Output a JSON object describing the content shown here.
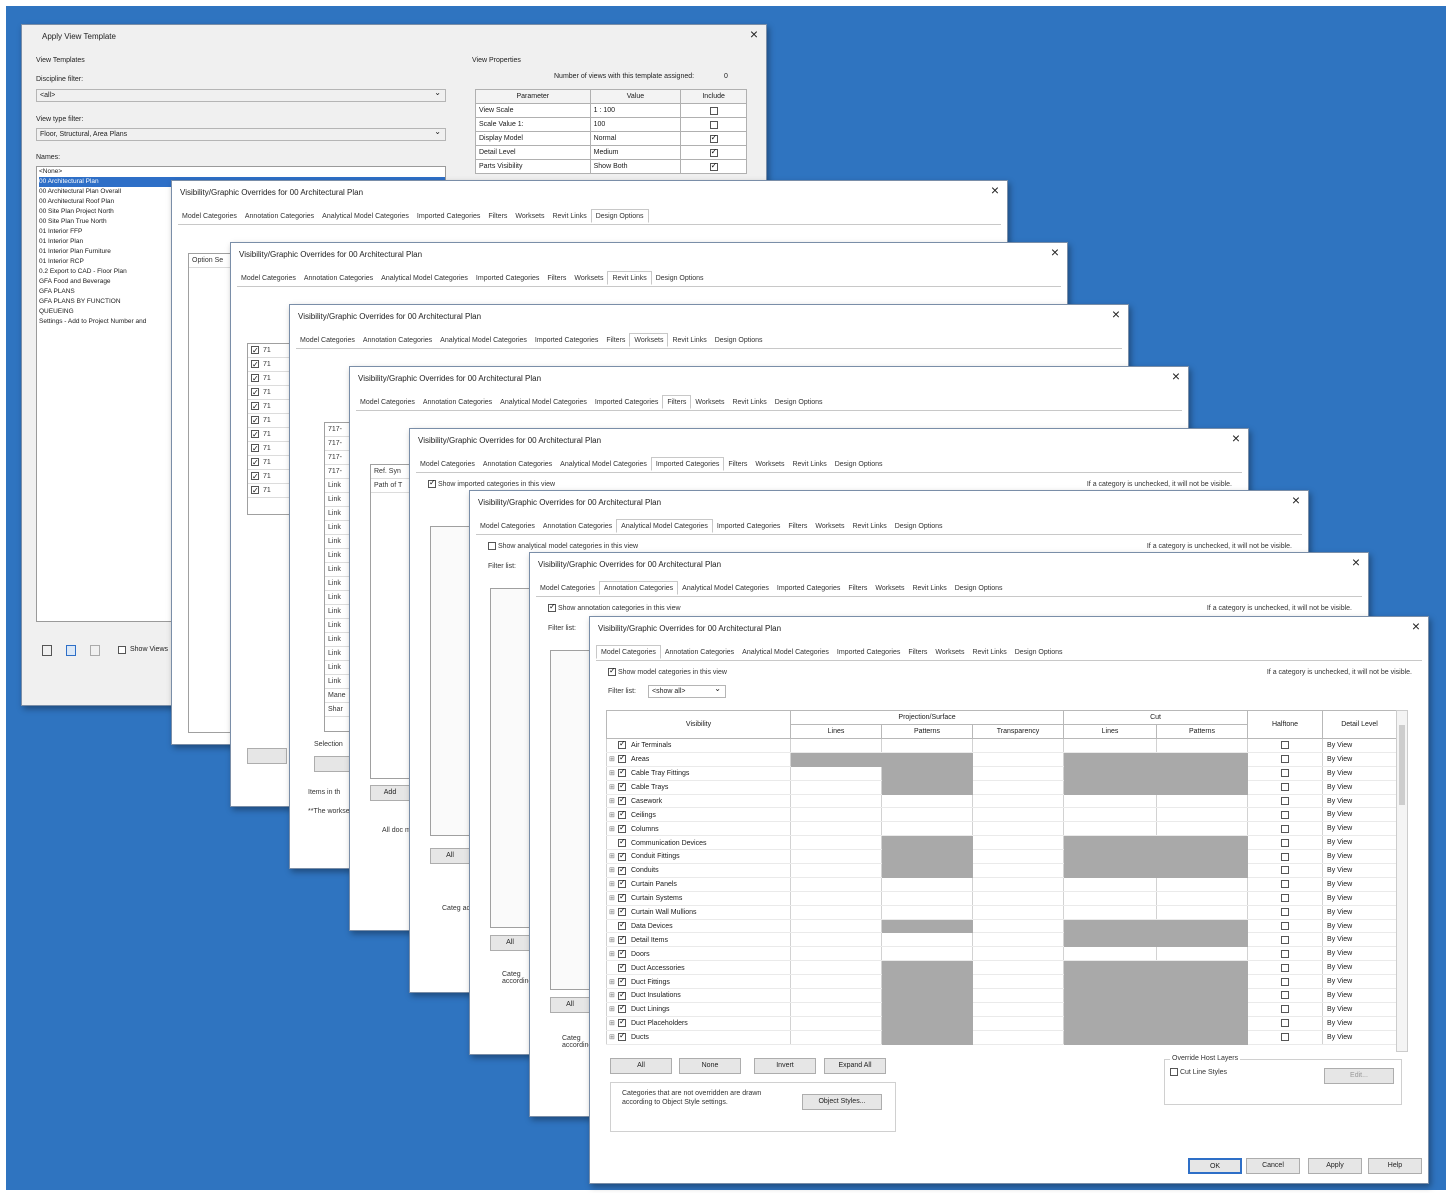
{
  "apply_template": {
    "title": "Apply View Template",
    "view_templates_label": "View Templates",
    "discipline_label": "Discipline filter:",
    "discipline_value": "<all>",
    "view_type_label": "View type filter:",
    "view_type_value": "Floor, Structural, Area Plans",
    "names_label": "Names:",
    "names": [
      "<None>",
      "00 Architectural Plan",
      "00 Architectural Plan Overall",
      "00 Architectural Roof Plan",
      "00 Site Plan Project North",
      "00 Site Plan True North",
      "01 Interior FFP",
      "01 Interior Plan",
      "01 Interior Plan Furniture",
      "01 Interior RCP",
      "0.2 Export to CAD - Floor Plan",
      "GFA Food and Beverage",
      "GFA PLANS",
      "GFA PLANS BY FUNCTION",
      "QUEUEING",
      "Settings - Add to Project Number and"
    ],
    "selected_index": 1,
    "view_properties_label": "View Properties",
    "num_views_label": "Number of views with this template assigned:",
    "num_views_value": "0",
    "props_headers": [
      "Parameter",
      "Value",
      "Include"
    ],
    "props_rows": [
      {
        "param": "View Scale",
        "value": "1 : 100",
        "include": false
      },
      {
        "param": "Scale Value  1:",
        "value": "100",
        "include": false
      },
      {
        "param": "Display Model",
        "value": "Normal",
        "include": true
      },
      {
        "param": "Detail Level",
        "value": "Medium",
        "include": true
      },
      {
        "param": "Parts Visibility",
        "value": "Show Both",
        "include": true
      }
    ],
    "show_views_label": "Show Views"
  },
  "vg_title": "Visibility/Graphic Overrides for 00 Architectural Plan",
  "tabs": [
    "Model Categories",
    "Annotation Categories",
    "Analytical Model Categories",
    "Imported Categories",
    "Filters",
    "Worksets",
    "Revit Links",
    "Design Options"
  ],
  "stack": {
    "option_set_label": "Option Se",
    "ref_label": "Ref. Syn",
    "path_label": "Path of T",
    "selection_label": "Selection",
    "items_label": "Items in th",
    "note_label": "**The workse",
    "all_label": "All",
    "show_imported": "Show imported categories in this view",
    "show_analytical": "Show analytical model categories in this view",
    "show_annotation": "Show annotation categories in this view",
    "unchecked_note": "If a category is unchecked, it will not be visible.",
    "filter_label": "Filter list:",
    "link_rows": [
      "71",
      "71",
      "71",
      "71",
      "71",
      "71",
      "71",
      "71",
      "71",
      "71",
      "71"
    ],
    "workset_rows": [
      "717-",
      "717-",
      "717-",
      "717-",
      "Link",
      "Link",
      "Link",
      "Link",
      "Link",
      "Link",
      "Link",
      "Link",
      "Link",
      "Link",
      "Link",
      "Link",
      "Link",
      "Link",
      "Link",
      "Mane",
      "Shar"
    ],
    "categ_label": "Categ according",
    "add_label": "Add"
  },
  "front": {
    "show_model": "Show model categories in this view",
    "unchecked_note": "If a category is unchecked, it will not be visible.",
    "filter_label": "Filter list:",
    "filter_value": "<show all>",
    "col_visibility": "Visibility",
    "col_projection": "Projection/Surface",
    "col_cut": "Cut",
    "col_halftone": "Halftone",
    "col_detail": "Detail Level",
    "sub_lines": "Lines",
    "sub_patterns": "Patterns",
    "sub_transparency": "Transparency",
    "rows": [
      {
        "name": "Air Terminals",
        "exp": false,
        "gray": []
      },
      {
        "name": "Areas",
        "exp": true,
        "gray": [
          "pl",
          "pp",
          "cl",
          "cp"
        ]
      },
      {
        "name": "Cable Tray Fittings",
        "exp": true,
        "gray": [
          "pp",
          "cl",
          "cp"
        ]
      },
      {
        "name": "Cable Trays",
        "exp": true,
        "gray": [
          "pp",
          "cl",
          "cp"
        ]
      },
      {
        "name": "Casework",
        "exp": true,
        "gray": []
      },
      {
        "name": "Ceilings",
        "exp": true,
        "gray": []
      },
      {
        "name": "Columns",
        "exp": true,
        "gray": []
      },
      {
        "name": "Communication Devices",
        "exp": false,
        "gray": [
          "pp",
          "cl",
          "cp"
        ]
      },
      {
        "name": "Conduit Fittings",
        "exp": true,
        "gray": [
          "pp",
          "cl",
          "cp"
        ]
      },
      {
        "name": "Conduits",
        "exp": true,
        "gray": [
          "pp",
          "cl",
          "cp"
        ]
      },
      {
        "name": "Curtain Panels",
        "exp": true,
        "gray": []
      },
      {
        "name": "Curtain Systems",
        "exp": true,
        "gray": []
      },
      {
        "name": "Curtain Wall Mullions",
        "exp": true,
        "gray": []
      },
      {
        "name": "Data Devices",
        "exp": false,
        "gray": [
          "pp",
          "cl",
          "cp"
        ]
      },
      {
        "name": "Detail Items",
        "exp": true,
        "gray": [
          "cl",
          "cp"
        ]
      },
      {
        "name": "Doors",
        "exp": true,
        "gray": []
      },
      {
        "name": "Duct Accessories",
        "exp": false,
        "gray": [
          "pp",
          "cl",
          "cp"
        ]
      },
      {
        "name": "Duct Fittings",
        "exp": true,
        "gray": [
          "pp",
          "cl",
          "cp"
        ]
      },
      {
        "name": "Duct Insulations",
        "exp": true,
        "gray": [
          "pp",
          "cl",
          "cp"
        ]
      },
      {
        "name": "Duct Linings",
        "exp": true,
        "gray": [
          "pp",
          "cl",
          "cp"
        ]
      },
      {
        "name": "Duct Placeholders",
        "exp": true,
        "gray": [
          "pp",
          "cl",
          "cp"
        ]
      },
      {
        "name": "Ducts",
        "exp": true,
        "gray": [
          "pp",
          "cl",
          "cp"
        ]
      }
    ],
    "detail_value": "By View",
    "btn_all": "All",
    "btn_none": "None",
    "btn_invert": "Invert",
    "btn_expand": "Expand All",
    "override_host_label": "Override Host Layers",
    "cut_line_styles": "Cut Line Styles",
    "edit_label": "Edit...",
    "object_styles_note": "Categories that are not overridden are drawn according to Object Style settings.",
    "object_styles_btn": "Object Styles...",
    "ok": "OK",
    "cancel": "Cancel",
    "apply": "Apply",
    "help": "Help"
  }
}
